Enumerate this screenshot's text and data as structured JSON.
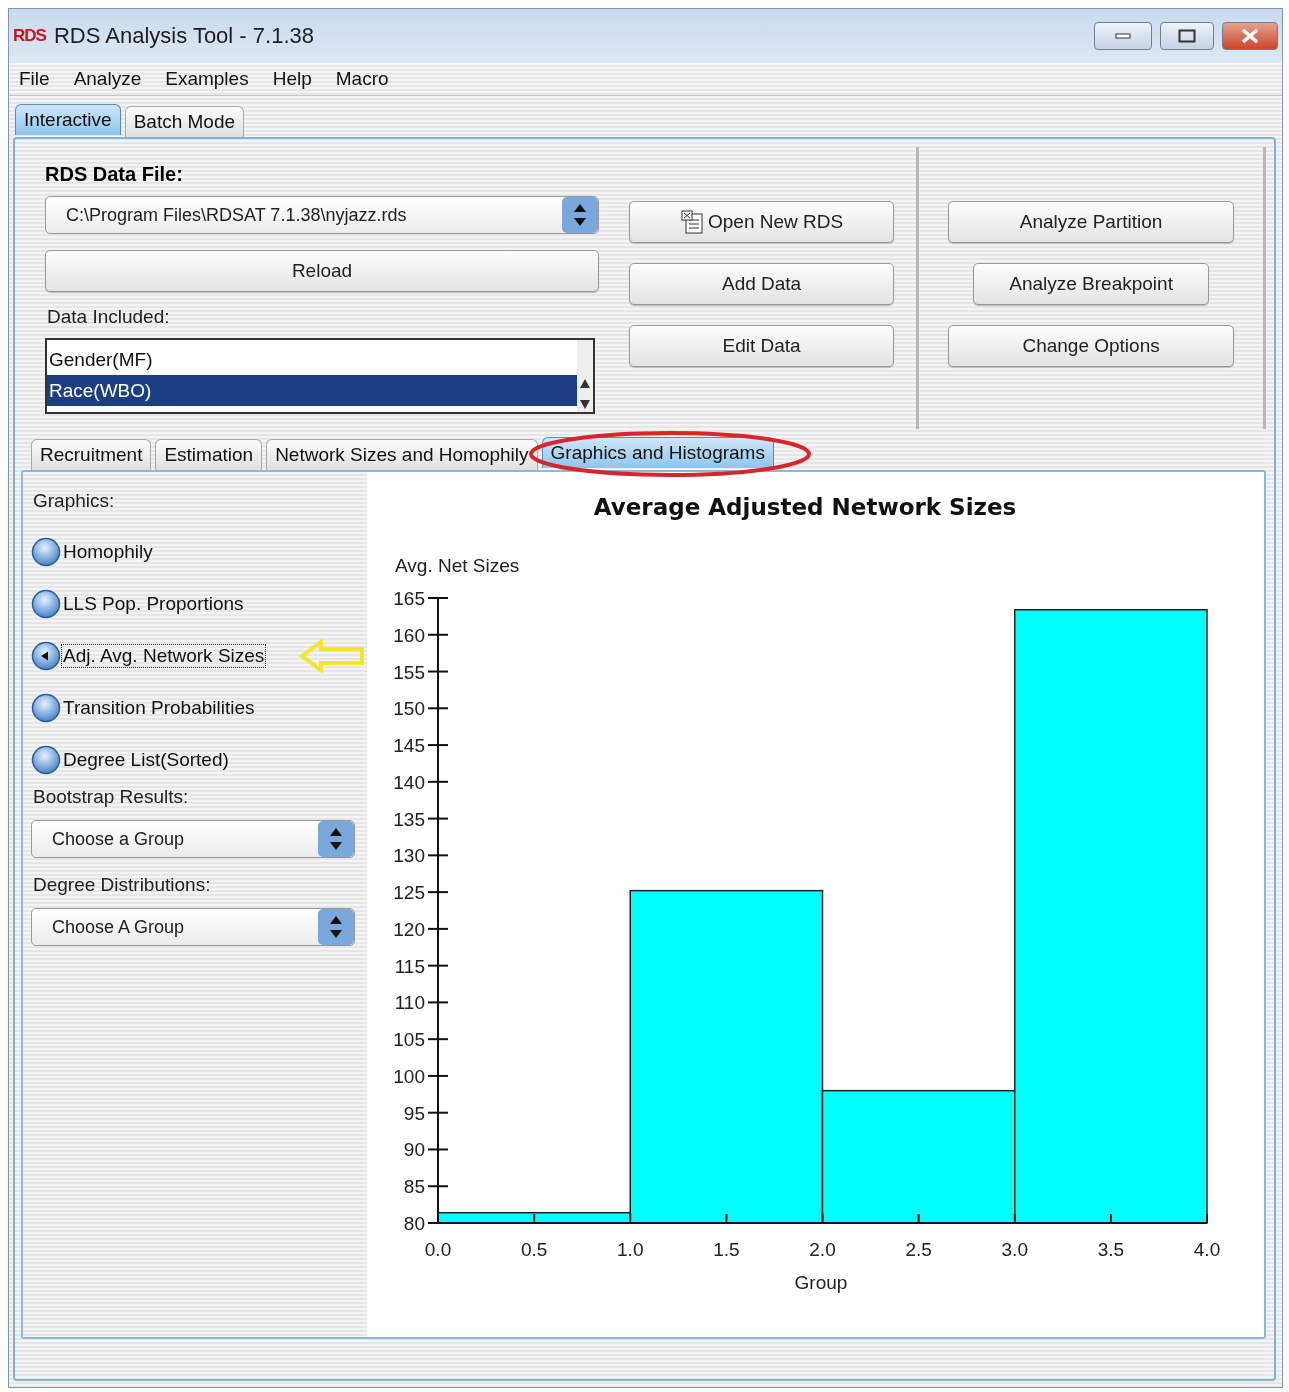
{
  "window": {
    "logo": "RDS",
    "title": "RDS Analysis Tool - 7.1.38"
  },
  "menu": [
    "File",
    "Analyze",
    "Examples",
    "Help",
    "Macro"
  ],
  "main_tabs": [
    {
      "label": "Interactive",
      "selected": true
    },
    {
      "label": "Batch Mode",
      "selected": false
    }
  ],
  "data_file": {
    "label": "RDS Data File:",
    "value": "C:\\Program Files\\RDSAT 7.1.38\\nyjazz.rds"
  },
  "reload_button": "Reload",
  "data_included": {
    "label": "Data Included:",
    "items": [
      {
        "label": "Gender(MF)",
        "selected": false
      },
      {
        "label": "Race(WBO)",
        "selected": true
      }
    ]
  },
  "file_buttons": [
    {
      "label": "Open New RDS",
      "kind": "icon"
    },
    {
      "label": "Add Data",
      "kind": "plain"
    },
    {
      "label": "Edit Data",
      "kind": "plain"
    }
  ],
  "analysis_buttons": [
    "Analyze Partition",
    "Analyze Breakpoint",
    "Change Options"
  ],
  "sub_tabs": [
    {
      "label": "Recruitment",
      "selected": false
    },
    {
      "label": "Estimation",
      "selected": false
    },
    {
      "label": "Network Sizes and Homophily",
      "selected": false
    },
    {
      "label": "Graphics and Histograms",
      "selected": true
    }
  ],
  "graphics": {
    "label": "Graphics:",
    "options": [
      {
        "label": "Homophily",
        "selected": false
      },
      {
        "label": "LLS Pop. Proportions",
        "selected": false
      },
      {
        "label": "Adj. Avg. Network Sizes",
        "selected": true
      },
      {
        "label": "Transition Probabilities",
        "selected": false
      },
      {
        "label": "Degree List(Sorted)",
        "selected": false
      }
    ]
  },
  "bootstrap": {
    "label": "Bootstrap Results:",
    "value": "Choose a Group"
  },
  "degree": {
    "label": "Degree Distributions:",
    "value": "Choose A Group"
  },
  "chart_data": {
    "type": "bar",
    "title": "Average Adjusted Network Sizes",
    "xlabel": "Group",
    "ylabel": "Avg. Net Sizes",
    "x": [
      0.5,
      1.5,
      2.5,
      3.5
    ],
    "values": [
      81.4,
      125.2,
      98.0,
      163.4
    ],
    "xlim": [
      0,
      4
    ],
    "ylim": [
      80,
      165
    ],
    "xticks": [
      {
        "value": 0,
        "label": "0.0"
      },
      {
        "value": 0.5,
        "label": "0.5"
      },
      {
        "value": 1,
        "label": "1.0"
      },
      {
        "value": 1.5,
        "label": "1.5"
      },
      {
        "value": 2,
        "label": "2.0"
      },
      {
        "value": 2.5,
        "label": "2.5"
      },
      {
        "value": 3,
        "label": "3.0"
      },
      {
        "value": 3.5,
        "label": "3.5"
      },
      {
        "value": 4,
        "label": "4.0"
      }
    ],
    "yticks": [
      80,
      85,
      90,
      95,
      100,
      105,
      110,
      115,
      120,
      125,
      130,
      135,
      140,
      145,
      150,
      155,
      160,
      165
    ]
  }
}
